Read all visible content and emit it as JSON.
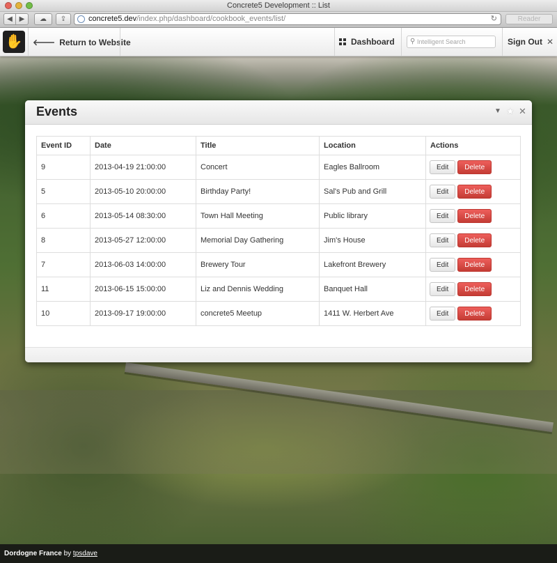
{
  "browser": {
    "window_title": "Concrete5 Development :: List",
    "url_host": "concrete5.dev",
    "url_path": "/index.php/dashboard/cookbook_events/list/",
    "reader_label": "Reader"
  },
  "ccm": {
    "return_label": "Return to Website",
    "dashboard_label": "Dashboard",
    "search_placeholder": "Intelligent Search",
    "signout_label": "Sign Out"
  },
  "panel": {
    "title": "Events",
    "columns": [
      "Event ID",
      "Date",
      "Title",
      "Location",
      "Actions"
    ],
    "rows": [
      {
        "id": "9",
        "date": "2013-04-19 21:00:00",
        "title": "Concert",
        "location": "Eagles Ballroom"
      },
      {
        "id": "5",
        "date": "2013-05-10 20:00:00",
        "title": "Birthday Party!",
        "location": "Sal's Pub and Grill"
      },
      {
        "id": "6",
        "date": "2013-05-14 08:30:00",
        "title": "Town Hall Meeting",
        "location": "Public library"
      },
      {
        "id": "8",
        "date": "2013-05-27 12:00:00",
        "title": "Memorial Day Gathering",
        "location": "Jim's House"
      },
      {
        "id": "7",
        "date": "2013-06-03 14:00:00",
        "title": "Brewery Tour",
        "location": "Lakefront Brewery"
      },
      {
        "id": "11",
        "date": "2013-06-15 15:00:00",
        "title": "Liz and Dennis Wedding",
        "location": "Banquet Hall"
      },
      {
        "id": "10",
        "date": "2013-09-17 19:00:00",
        "title": "concrete5 Meetup",
        "location": "1411 W. Herbert Ave"
      }
    ],
    "edit_label": "Edit",
    "delete_label": "Delete"
  },
  "credit": {
    "place": "Dordogne France",
    "by": "by",
    "author": "tpsdave"
  },
  "colors": {
    "delete_button": "#d9443e",
    "toolbar_bg": "#f5f5f5"
  }
}
